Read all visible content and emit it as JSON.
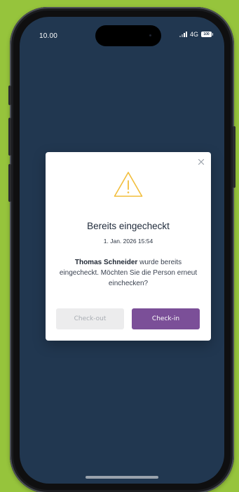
{
  "status_bar": {
    "time": "10.00",
    "network": "4G",
    "battery_label": "100"
  },
  "dialog": {
    "title": "Bereits eingecheckt",
    "date": "1. Jan. 2026 15:54",
    "message": {
      "name": "Thomas Schneider",
      "text": " wurde bereits eingecheckt. Möchten Sie die Person erneut einchecken?"
    },
    "buttons": {
      "checkout": "Check-out",
      "checkin": "Check-in"
    },
    "icons": {
      "close": "close-icon",
      "warning": "warning-icon"
    }
  },
  "colors": {
    "background": "#96c43c",
    "screen": "#213750",
    "warning": "#f2be3c",
    "primary_button": "#7b4f98",
    "disabled_button": "#ececed"
  }
}
